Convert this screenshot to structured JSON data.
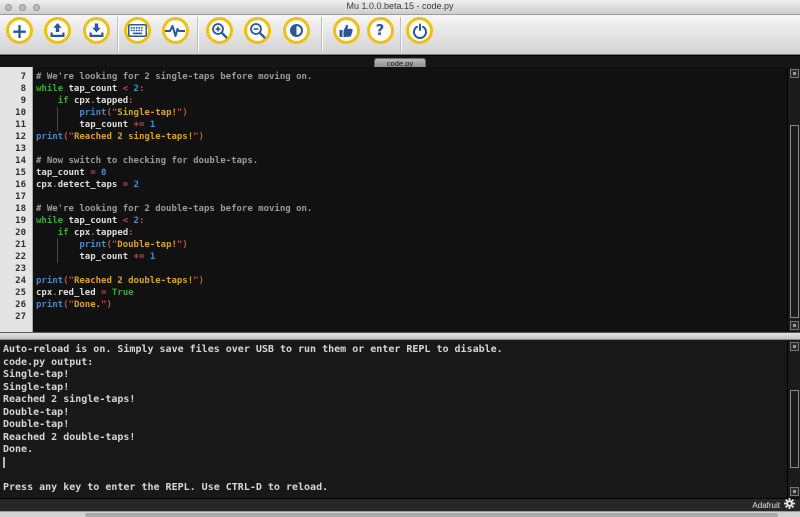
{
  "window": {
    "title": "Mu 1.0.0.beta.15 - code.py",
    "traffic_lights": [
      "close",
      "minimize",
      "maximize"
    ]
  },
  "toolbar": {
    "buttons": [
      {
        "name": "new",
        "icon": "plus-icon"
      },
      {
        "name": "load",
        "icon": "upload-icon"
      },
      {
        "name": "save",
        "icon": "download-icon"
      },
      {
        "name": "serial",
        "icon": "keyboard-icon"
      },
      {
        "name": "plotter",
        "icon": "pulse-icon"
      },
      {
        "name": "zoom-in",
        "icon": "magnifier-plus-icon"
      },
      {
        "name": "zoom-out",
        "icon": "magnifier-minus-icon"
      },
      {
        "name": "theme",
        "icon": "contrast-icon"
      },
      {
        "name": "check",
        "icon": "thumbs-up-icon"
      },
      {
        "name": "help",
        "icon": "question-icon"
      },
      {
        "name": "quit",
        "icon": "power-icon"
      }
    ]
  },
  "tab": {
    "label": "code.py"
  },
  "editor": {
    "lines": [
      {
        "n": 7,
        "segs": [
          [
            "c",
            "# We're looking for 2 single-taps before moving on."
          ]
        ]
      },
      {
        "n": 8,
        "segs": [
          [
            "k",
            "while "
          ],
          [
            "i",
            "tap_count "
          ],
          [
            "o",
            "< "
          ],
          [
            "num",
            "2"
          ],
          [
            "o",
            ":"
          ]
        ]
      },
      {
        "n": 9,
        "segs": [
          [
            "i",
            "    "
          ],
          [
            "k",
            "if "
          ],
          [
            "i",
            "cpx"
          ],
          [
            "o",
            "."
          ],
          [
            "i",
            "tapped"
          ],
          [
            "o",
            ":"
          ]
        ]
      },
      {
        "n": 10,
        "segs": [
          [
            "i",
            "        "
          ],
          [
            "f",
            "print"
          ],
          [
            "o",
            "(\""
          ],
          [
            "s",
            "Single-tap!"
          ],
          [
            "o",
            "\")"
          ]
        ]
      },
      {
        "n": 11,
        "segs": [
          [
            "i",
            "        "
          ],
          [
            "i",
            "tap_count "
          ],
          [
            "o",
            "+= "
          ],
          [
            "num",
            "1"
          ]
        ]
      },
      {
        "n": 12,
        "segs": [
          [
            "f",
            "print"
          ],
          [
            "o",
            "(\""
          ],
          [
            "s",
            "Reached 2 single-taps!"
          ],
          [
            "o",
            "\")"
          ]
        ]
      },
      {
        "n": 13,
        "segs": []
      },
      {
        "n": 14,
        "segs": [
          [
            "c",
            "# Now switch to checking for double-taps."
          ]
        ]
      },
      {
        "n": 15,
        "segs": [
          [
            "i",
            "tap_count "
          ],
          [
            "o",
            "= "
          ],
          [
            "num",
            "0"
          ]
        ]
      },
      {
        "n": 16,
        "segs": [
          [
            "i",
            "cpx"
          ],
          [
            "o",
            "."
          ],
          [
            "i",
            "detect_taps "
          ],
          [
            "o",
            "= "
          ],
          [
            "num",
            "2"
          ]
        ]
      },
      {
        "n": 17,
        "segs": []
      },
      {
        "n": 18,
        "segs": [
          [
            "c",
            "# We're looking for 2 double-taps before moving on."
          ]
        ]
      },
      {
        "n": 19,
        "segs": [
          [
            "k",
            "while "
          ],
          [
            "i",
            "tap_count "
          ],
          [
            "o",
            "< "
          ],
          [
            "num",
            "2"
          ],
          [
            "o",
            ":"
          ]
        ]
      },
      {
        "n": 20,
        "segs": [
          [
            "i",
            "    "
          ],
          [
            "k",
            "if "
          ],
          [
            "i",
            "cpx"
          ],
          [
            "o",
            "."
          ],
          [
            "i",
            "tapped"
          ],
          [
            "o",
            ":"
          ]
        ]
      },
      {
        "n": 21,
        "segs": [
          [
            "i",
            "        "
          ],
          [
            "f",
            "print"
          ],
          [
            "o",
            "(\""
          ],
          [
            "s",
            "Double-tap!"
          ],
          [
            "o",
            "\")"
          ]
        ]
      },
      {
        "n": 22,
        "segs": [
          [
            "i",
            "        "
          ],
          [
            "i",
            "tap_count "
          ],
          [
            "o",
            "+= "
          ],
          [
            "num",
            "1"
          ]
        ]
      },
      {
        "n": 23,
        "segs": []
      },
      {
        "n": 24,
        "segs": [
          [
            "f",
            "print"
          ],
          [
            "o",
            "(\""
          ],
          [
            "s",
            "Reached 2 double-taps!"
          ],
          [
            "o",
            "\")"
          ]
        ]
      },
      {
        "n": 25,
        "segs": [
          [
            "i",
            "cpx"
          ],
          [
            "o",
            "."
          ],
          [
            "i",
            "red_led "
          ],
          [
            "o",
            "= "
          ],
          [
            "k",
            "True"
          ]
        ]
      },
      {
        "n": 26,
        "segs": [
          [
            "f",
            "print"
          ],
          [
            "o",
            "(\""
          ],
          [
            "s",
            "Done."
          ],
          [
            "o",
            "\")"
          ]
        ]
      },
      {
        "n": 27,
        "segs": []
      }
    ]
  },
  "repl": {
    "lines": [
      "Auto-reload is on. Simply save files over USB to run them or enter REPL to disable.",
      "code.py output:",
      "Single-tap!",
      "Single-tap!",
      "Reached 2 single-taps!",
      "Double-tap!",
      "Double-tap!",
      "Reached 2 double-taps!",
      "Done.",
      "",
      "",
      "Press any key to enter the REPL. Use CTRL-D to reload."
    ],
    "cursor_line_index": 9
  },
  "statusbar": {
    "device_label": "Adafruit",
    "gear_icon": "gear-icon"
  },
  "colors": {
    "accent_yellow": "#f0c011",
    "icon_blue": "#2b5797",
    "syntax_keyword": "#3da639",
    "syntax_comment": "#9a9a9a",
    "syntax_identifier": "#dfdfdf",
    "syntax_operator": "#c2504a",
    "syntax_number": "#3e8ed0",
    "syntax_function": "#4a86c8",
    "syntax_string": "#d7a32a",
    "editor_bg": "#111111",
    "repl_bg": "#181818"
  }
}
